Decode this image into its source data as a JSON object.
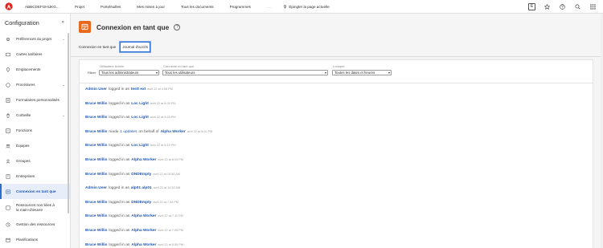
{
  "topbar": {
    "org": "ABBCDEFGHIJKG...",
    "nav": [
      "Projet",
      "Portefeuilles",
      "Mes mises à jour",
      "Tous les documents",
      "Programmes",
      "....."
    ],
    "pin_label": "Épingler la page actuelle",
    "box_label": "E"
  },
  "sidebar": {
    "title": "Configuration",
    "collapse": "«",
    "items": [
      {
        "label": "Préférences du projet",
        "icon": "gear-icon",
        "chev": true
      },
      {
        "label": "Cartes tarifaires",
        "icon": "card-icon",
        "chev": false
      },
      {
        "label": "Emplacements",
        "icon": "location-icon",
        "chev": false
      },
      {
        "label": "Procédures",
        "icon": "procedure-icon",
        "chev": true
      },
      {
        "label": "Formulaires personnalisés",
        "icon": "form-icon",
        "chev": false
      },
      {
        "label": "Corbeille",
        "icon": "trash-icon",
        "chev": true
      },
      {
        "label": "Fonctions",
        "icon": "function-icon",
        "chev": false
      },
      {
        "label": "Équipes",
        "icon": "team-icon",
        "chev": false
      },
      {
        "label": "Groupes",
        "icon": "group-icon",
        "chev": false
      },
      {
        "label": "Entreprises",
        "icon": "company-icon",
        "chev": false
      },
      {
        "label": "Connexion en tant que",
        "icon": "login-as-icon",
        "chev": false,
        "active": true
      },
      {
        "label": "Ressources non liées à la main-d'œuvre",
        "icon": "resource-icon",
        "chev": false
      },
      {
        "label": "Gestion des ressources",
        "icon": "resource-management-icon",
        "chev": false
      },
      {
        "label": "Planifications",
        "icon": "calendar-icon",
        "chev": false
      }
    ]
  },
  "page": {
    "title": "Connexion en tant que",
    "help": "?",
    "tabs": [
      "Connexion en tant que",
      "Journal d'accès"
    ]
  },
  "filters": {
    "label": "Filtrer",
    "admin": {
      "label": "Utilisateur Admin",
      "value": "Tous les administrateurs"
    },
    "user": {
      "label": "Connecté en tant que",
      "value": "Tous les utilisateurs"
    },
    "date": {
      "label": "Lorsque",
      "value": "Toutes les dates et heures"
    }
  },
  "log": [
    {
      "user": "Admin User",
      "action": "logged in as",
      "target": "testt ext",
      "time": "avril 22 at 4:08 PM"
    },
    {
      "user": "Bruce Willis",
      "action": "logged in as",
      "target": "Loc Light",
      "time": "avril 22 at 8:29 PM"
    },
    {
      "user": "Bruce Willis",
      "action": "logged in as",
      "target": "Loc Light",
      "time": "avril 22 at 8:25 PM"
    },
    {
      "user": "Bruce Willis",
      "action": "made",
      "extra": "1 updates",
      "action2": "on behalf of",
      "target": "Alpha Worker",
      "time": "avril 22 at 8:20 PM"
    },
    {
      "user": "Bruce Willis",
      "action": "logged in as",
      "target": "Loc Light",
      "time": "avril 22 at 8:19 PM"
    },
    {
      "user": "Bruce Willis",
      "action": "logged in as",
      "target": "Alpha Worker",
      "time": "avril 22 at 8:09 PM"
    },
    {
      "user": "Bruce Willis",
      "action": "logged in as",
      "target": "DNDEmpty",
      "time": "avril 22 at 10:59 AM"
    },
    {
      "user": "Admin User",
      "action": "logged in as",
      "target": "alp01 alp01",
      "time": "avril 22 at 10:52 AM"
    },
    {
      "user": "Bruce Willis",
      "action": "logged in as",
      "target": "DNDEmpty",
      "time": "avril 22 at 7:34 PM"
    },
    {
      "user": "Bruce Willis",
      "action": "logged in as",
      "target": "Alpha Worker",
      "time": "avril 22 at 7:11 PM"
    },
    {
      "user": "Bruce Willis",
      "action": "logged in as",
      "target": "Alpha Worker",
      "time": "avril 22 at 7:06 PM"
    },
    {
      "user": "Bruce Willis",
      "action": "logged in as",
      "target": "Alpha Worker",
      "time": "avril 22 at 5:56 PM"
    }
  ]
}
